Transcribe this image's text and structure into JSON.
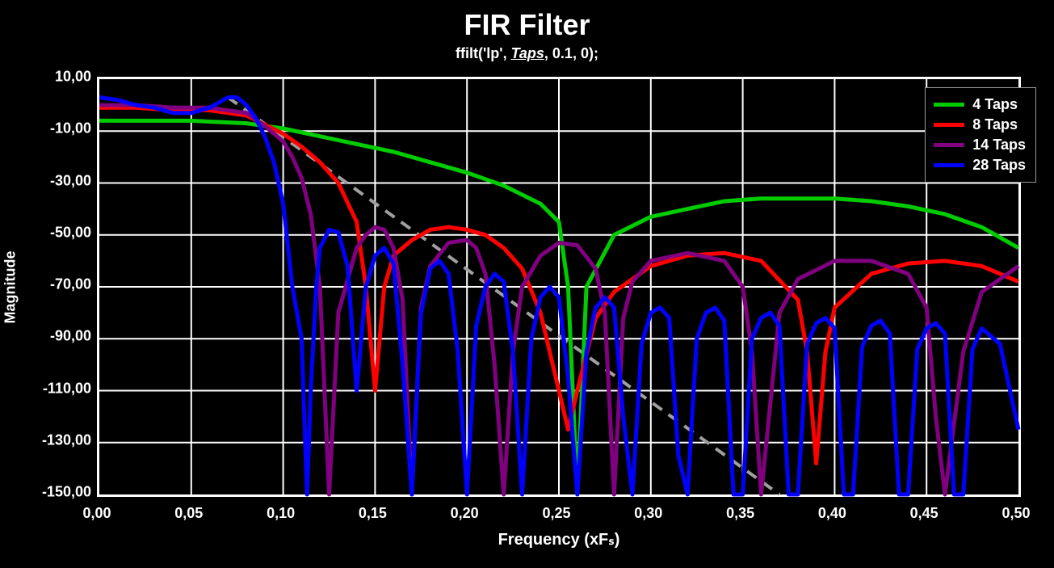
{
  "title": "FIR Filter",
  "subtitle_pre": "ffilt('lp', ",
  "subtitle_taps": "Taps",
  "subtitle_post": ", 0.1, 0);",
  "xlabel": "Frequency (xFₛ)",
  "ylabel": "Magnitude",
  "xticks": [
    "0,00",
    "0,05",
    "0,10",
    "0,15",
    "0,20",
    "0,25",
    "0,30",
    "0,35",
    "0,40",
    "0,45",
    "0,50"
  ],
  "yticks": [
    "10,00",
    "-10,00",
    "-30,00",
    "-50,00",
    "-70,00",
    "-90,00",
    "-110,00",
    "-130,00",
    "-150,00"
  ],
  "legend": [
    {
      "label": "4 Taps",
      "color": "#00cc00"
    },
    {
      "label": "8 Taps",
      "color": "#ff0000"
    },
    {
      "label": "14 Taps",
      "color": "#800080"
    },
    {
      "label": "28 Taps",
      "color": "#0000ff"
    }
  ],
  "chart_data": {
    "type": "line",
    "title": "FIR Filter",
    "xlabel": "Frequency (xFₛ)",
    "ylabel": "Magnitude",
    "xlim": [
      0,
      0.5
    ],
    "ylim": [
      -150,
      10
    ],
    "grid": true,
    "legend_position": "top-right",
    "annotation_dashed_line": {
      "from": [
        0.07,
        3
      ],
      "to": [
        0.37,
        -150
      ],
      "style": "dashed",
      "color": "#a0a0a0"
    },
    "series": [
      {
        "name": "4 Taps",
        "color": "#00cc00",
        "x": [
          0,
          0.02,
          0.05,
          0.08,
          0.1,
          0.12,
          0.14,
          0.16,
          0.18,
          0.2,
          0.22,
          0.24,
          0.25,
          0.255,
          0.26,
          0.265,
          0.28,
          0.3,
          0.32,
          0.34,
          0.36,
          0.38,
          0.4,
          0.42,
          0.44,
          0.46,
          0.48,
          0.5
        ],
        "y": [
          -6,
          -6,
          -6,
          -7,
          -9,
          -12,
          -15,
          -18,
          -22,
          -26,
          -31,
          -38,
          -45,
          -70,
          -150,
          -70,
          -50,
          -43,
          -40,
          -37,
          -36,
          -36,
          -36,
          -37,
          -39,
          -42,
          -47,
          -55
        ]
      },
      {
        "name": "8 Taps",
        "color": "#ff0000",
        "x": [
          0,
          0.02,
          0.04,
          0.06,
          0.08,
          0.1,
          0.11,
          0.12,
          0.13,
          0.14,
          0.145,
          0.15,
          0.155,
          0.16,
          0.17,
          0.18,
          0.19,
          0.2,
          0.21,
          0.22,
          0.23,
          0.24,
          0.25,
          0.255,
          0.26,
          0.27,
          0.28,
          0.3,
          0.32,
          0.34,
          0.36,
          0.38,
          0.385,
          0.39,
          0.395,
          0.4,
          0.42,
          0.44,
          0.46,
          0.48,
          0.5
        ],
        "y": [
          -1,
          -1,
          -2,
          -2,
          -4,
          -11,
          -16,
          -22,
          -30,
          -45,
          -70,
          -110,
          -70,
          -58,
          -52,
          -48,
          -47,
          -48,
          -50,
          -55,
          -63,
          -80,
          -110,
          -125,
          -110,
          -82,
          -72,
          -62,
          -58,
          -57,
          -60,
          -75,
          -95,
          -138,
          -95,
          -78,
          -65,
          -61,
          -60,
          -62,
          -68
        ]
      },
      {
        "name": "14 Taps",
        "color": "#800080",
        "x": [
          0,
          0.02,
          0.04,
          0.06,
          0.08,
          0.09,
          0.1,
          0.105,
          0.11,
          0.115,
          0.12,
          0.125,
          0.13,
          0.14,
          0.145,
          0.15,
          0.155,
          0.16,
          0.165,
          0.17,
          0.175,
          0.18,
          0.19,
          0.2,
          0.205,
          0.21,
          0.215,
          0.22,
          0.225,
          0.23,
          0.24,
          0.25,
          0.26,
          0.27,
          0.275,
          0.28,
          0.285,
          0.29,
          0.3,
          0.32,
          0.34,
          0.35,
          0.355,
          0.36,
          0.37,
          0.38,
          0.4,
          0.42,
          0.44,
          0.45,
          0.455,
          0.46,
          0.47,
          0.48,
          0.5
        ],
        "y": [
          0,
          0,
          -1,
          -1,
          -3,
          -8,
          -14,
          -20,
          -28,
          -42,
          -70,
          -150,
          -80,
          -55,
          -50,
          -47,
          -48,
          -55,
          -75,
          -150,
          -78,
          -62,
          -53,
          -52,
          -55,
          -65,
          -100,
          -150,
          -95,
          -70,
          -58,
          -53,
          -54,
          -63,
          -80,
          -150,
          -82,
          -68,
          -60,
          -57,
          -60,
          -70,
          -95,
          -150,
          -80,
          -67,
          -60,
          -60,
          -65,
          -78,
          -120,
          -150,
          -95,
          -72,
          -62
        ]
      },
      {
        "name": "28 Taps",
        "color": "#0000ff",
        "x": [
          0,
          0.01,
          0.02,
          0.03,
          0.04,
          0.05,
          0.06,
          0.065,
          0.07,
          0.075,
          0.08,
          0.085,
          0.09,
          0.095,
          0.1,
          0.105,
          0.11,
          0.113,
          0.115,
          0.118,
          0.12,
          0.125,
          0.13,
          0.135,
          0.14,
          0.145,
          0.15,
          0.155,
          0.16,
          0.165,
          0.17,
          0.175,
          0.18,
          0.185,
          0.19,
          0.195,
          0.2,
          0.205,
          0.21,
          0.215,
          0.22,
          0.225,
          0.23,
          0.235,
          0.24,
          0.245,
          0.25,
          0.255,
          0.26,
          0.265,
          0.27,
          0.275,
          0.28,
          0.285,
          0.29,
          0.295,
          0.3,
          0.305,
          0.31,
          0.315,
          0.32,
          0.325,
          0.33,
          0.335,
          0.34,
          0.345,
          0.35,
          0.355,
          0.36,
          0.365,
          0.37,
          0.375,
          0.38,
          0.385,
          0.39,
          0.395,
          0.4,
          0.405,
          0.41,
          0.415,
          0.42,
          0.425,
          0.43,
          0.435,
          0.44,
          0.445,
          0.45,
          0.455,
          0.46,
          0.465,
          0.47,
          0.475,
          0.48,
          0.49,
          0.5
        ],
        "y": [
          3,
          2,
          0,
          -1,
          -3,
          -3,
          -1,
          1,
          3,
          3,
          0,
          -5,
          -12,
          -22,
          -38,
          -70,
          -90,
          -150,
          -110,
          -70,
          -55,
          -48,
          -49,
          -62,
          -110,
          -70,
          -58,
          -55,
          -61,
          -100,
          -150,
          -80,
          -63,
          -60,
          -65,
          -95,
          -150,
          -85,
          -70,
          -65,
          -68,
          -95,
          -150,
          -90,
          -74,
          -70,
          -74,
          -105,
          -150,
          -95,
          -78,
          -74,
          -78,
          -120,
          -150,
          -92,
          -80,
          -78,
          -82,
          -135,
          -150,
          -90,
          -80,
          -78,
          -83,
          -150,
          -150,
          -90,
          -82,
          -80,
          -85,
          -150,
          -150,
          -92,
          -84,
          -82,
          -86,
          -150,
          -150,
          -93,
          -85,
          -83,
          -88,
          -150,
          -150,
          -94,
          -86,
          -84,
          -88,
          -150,
          -150,
          -94,
          -86,
          -92,
          -125
        ]
      }
    ]
  }
}
